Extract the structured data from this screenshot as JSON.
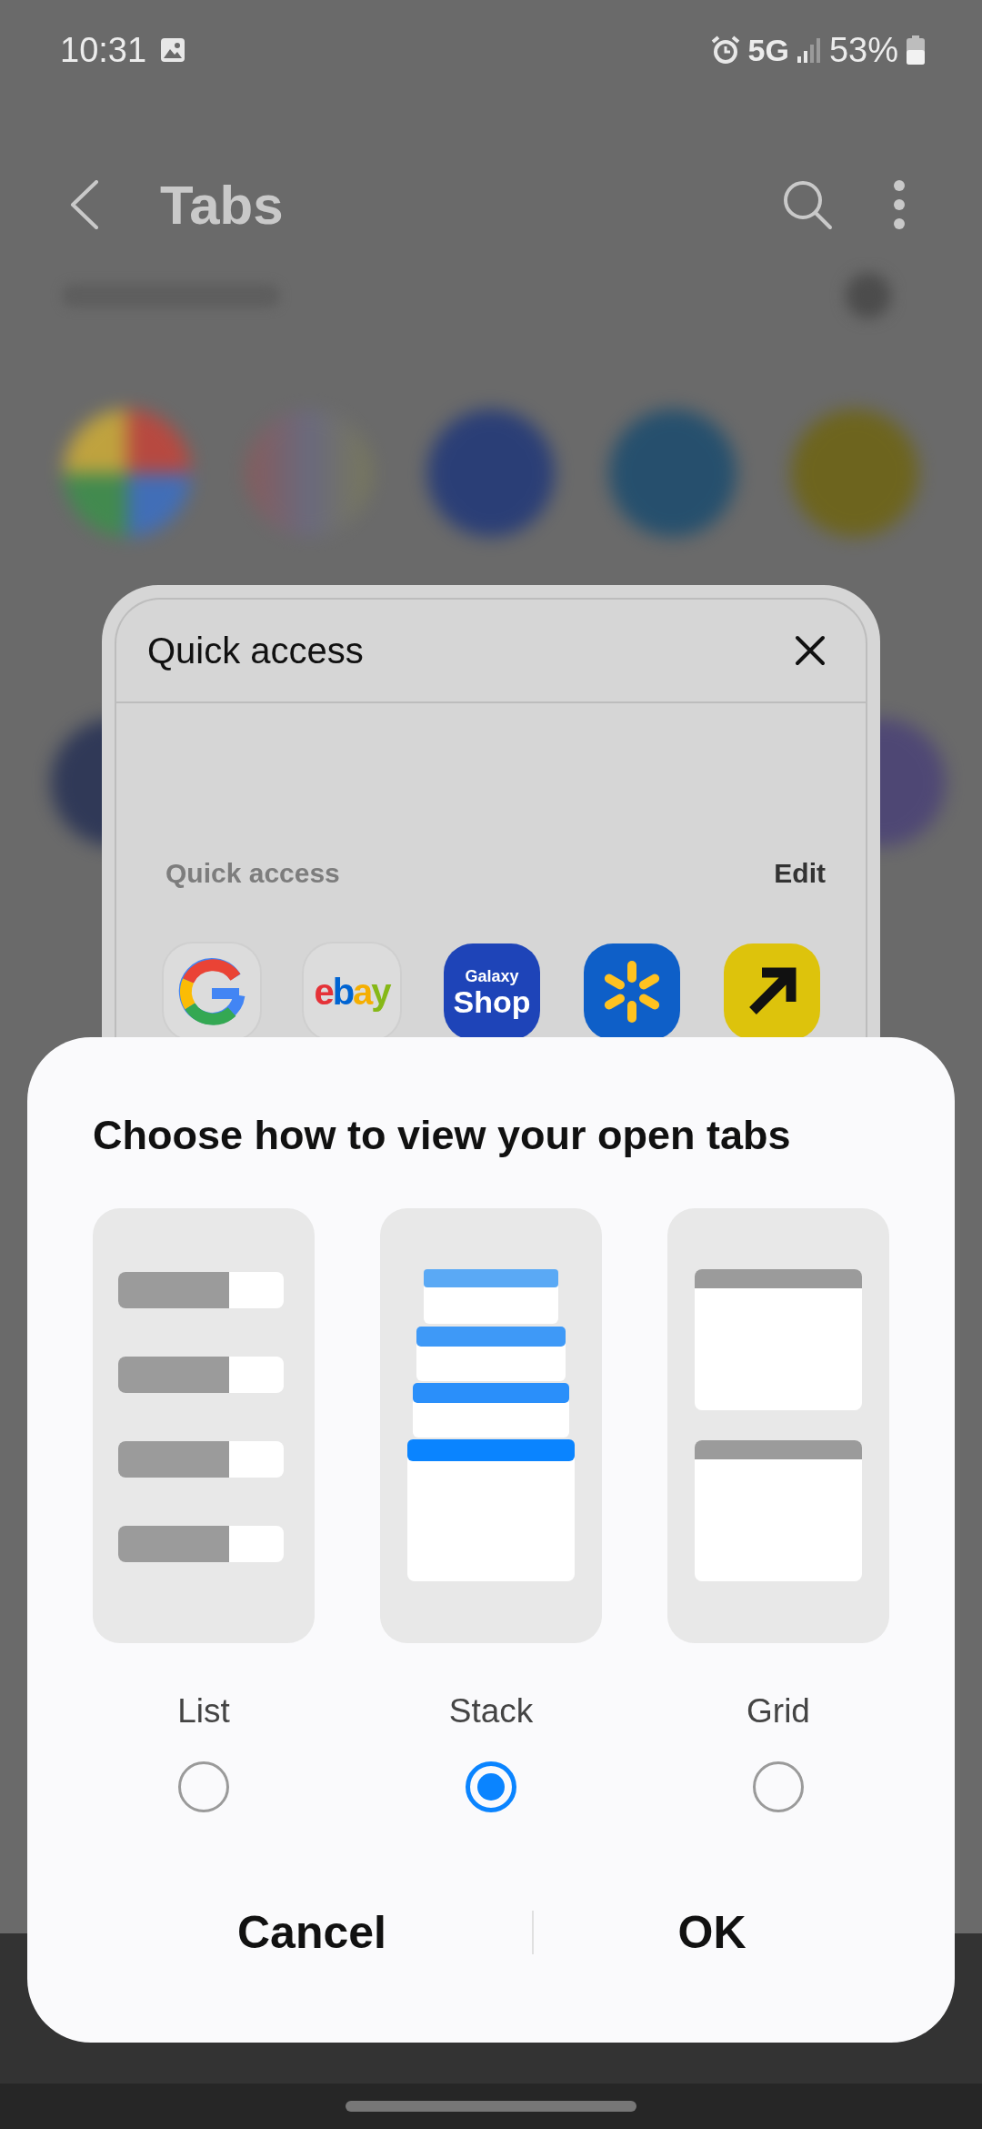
{
  "status_bar": {
    "time": "10:31",
    "network": "5G",
    "battery": "53%"
  },
  "app_bar": {
    "title": "Tabs"
  },
  "quick_access_panel": {
    "title": "Quick access",
    "section_label": "Quick access",
    "edit": "Edit",
    "apps": [
      {
        "kind": "google"
      },
      {
        "kind": "ebay",
        "label": "ebay"
      },
      {
        "kind": "galaxy_shop",
        "label_top": "Galaxy",
        "label_bottom": "Shop"
      },
      {
        "kind": "walmart"
      },
      {
        "kind": "arrow"
      }
    ]
  },
  "dialog": {
    "title": "Choose how to view your open tabs",
    "options": [
      {
        "kind": "list",
        "label": "List",
        "selected": false
      },
      {
        "kind": "stack",
        "label": "Stack",
        "selected": true
      },
      {
        "kind": "grid",
        "label": "Grid",
        "selected": false
      }
    ],
    "buttons": [
      "Cancel",
      "OK"
    ]
  }
}
